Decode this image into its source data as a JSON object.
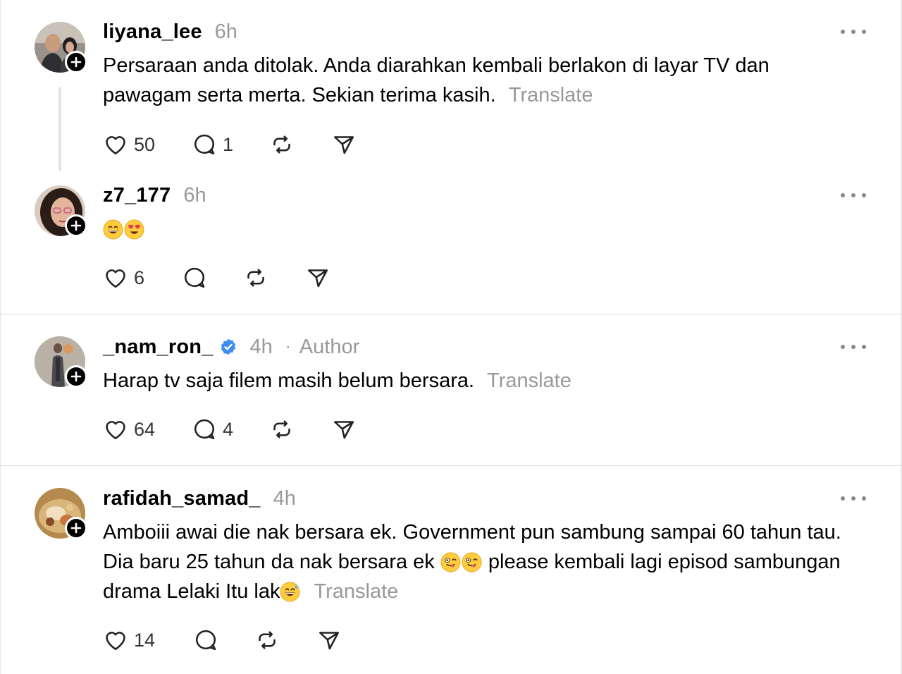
{
  "translate_label": "Translate",
  "icons": {
    "like": "heart-icon",
    "reply": "speech-bubble-icon",
    "repost": "repost-icon",
    "share": "send-icon",
    "more": "ellipsis-icon",
    "follow": "plus-icon",
    "verified": "verified-badge-icon"
  },
  "colors": {
    "text": "#000000",
    "muted": "#999999",
    "verified": "#3d8ef0",
    "divider": "#dcdcdc"
  },
  "posts": [
    {
      "username": "liyana_lee",
      "time": "6h",
      "text": "Persaraan anda ditolak. Anda diarahkan kembali berlakon di layar TV dan pawagam serta merta. Sekian terima kasih.",
      "likes": "50",
      "replies": "1"
    },
    {
      "username": "z7_177",
      "time": "6h",
      "emojis": [
        "😄",
        "😍"
      ],
      "likes": "6"
    },
    {
      "username": "_nam_ron_",
      "time": "4h",
      "separator": "·",
      "role": "Author",
      "text": "Harap tv saja filem masih belum bersara.",
      "likes": "64",
      "replies": "4"
    },
    {
      "username": "rafidah_samad_",
      "time": "4h",
      "text_part1": "Amboiii awai die nak bersara ek. Government pun sambung sampai 60 tahun tau. Dia baru 25 tahun da nak bersara ek",
      "text_part2": " please kembali lagi episod sambungan drama Lelaki Itu lak",
      "likes": "14"
    }
  ]
}
